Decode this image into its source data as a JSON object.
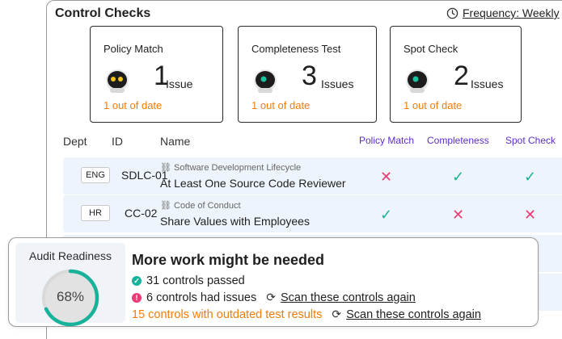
{
  "header": {
    "title": "Control Checks",
    "frequency_label": "Frequency: Weekly"
  },
  "cards": [
    {
      "title": "Policy Match",
      "count": "1",
      "unit": "Issue",
      "stale": "1 out of date",
      "robot_eyes": "#f5c518"
    },
    {
      "title": "Completeness Test",
      "count": "3",
      "unit": "Issues",
      "stale": "1 out of date",
      "robot_eyes": "#19c3a0"
    },
    {
      "title": "Spot Check",
      "count": "2",
      "unit": "Issues",
      "stale": "1 out of date",
      "robot_eyes": "#19c3a0"
    }
  ],
  "table": {
    "headers": {
      "dept": "Dept",
      "id": "ID",
      "name": "Name",
      "policy": "Policy Match",
      "completeness": "Completeness",
      "spot": "Spot Check"
    },
    "rows": [
      {
        "dept": "ENG",
        "id": "SDLC-01",
        "category": "Software Development Lifecycle",
        "name": "At Least One Source Code Reviewer",
        "policy": "fail",
        "completeness": "pass",
        "spot": "pass"
      },
      {
        "dept": "HR",
        "id": "CC-02",
        "category": "Code of Conduct",
        "name": "Share Values with Employees",
        "policy": "pass",
        "completeness": "fail",
        "spot": "fail"
      }
    ]
  },
  "audit": {
    "title": "Audit Readiness",
    "percent_label": "68%",
    "percent": 68,
    "heading": "More work might be needed",
    "passed": "31 controls passed",
    "issues": "6 controls had issues",
    "scan_again": "Scan these controls again",
    "outdated": "15 controls with outdated test results",
    "scan_again_2": "Scan these controls again"
  },
  "colors": {
    "accent": "#5b2dc7",
    "pass": "#18b29a",
    "fail": "#ec3a74",
    "stale": "#f07d0b"
  }
}
